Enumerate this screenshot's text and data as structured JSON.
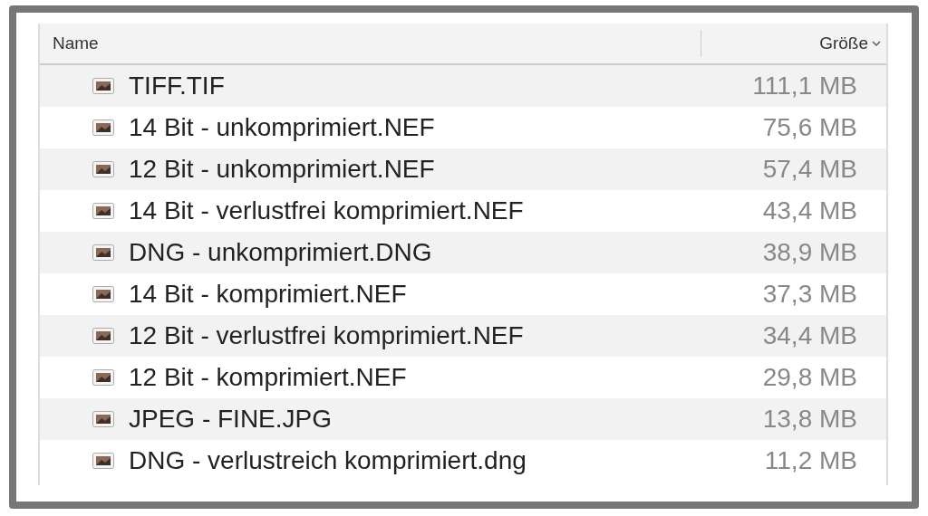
{
  "columns": [
    {
      "label": "Name"
    },
    {
      "label": "Größe"
    }
  ],
  "rows": [
    {
      "name": "TIFF.TIF",
      "size": "111,1 MB"
    },
    {
      "name": "14 Bit - unkomprimiert.NEF",
      "size": "75,6 MB"
    },
    {
      "name": "12 Bit - unkomprimiert.NEF",
      "size": "57,4 MB"
    },
    {
      "name": "14 Bit - verlustfrei komprimiert.NEF",
      "size": "43,4 MB"
    },
    {
      "name": "DNG - unkomprimiert.DNG",
      "size": "38,9 MB"
    },
    {
      "name": "14 Bit - komprimiert.NEF",
      "size": "37,3 MB"
    },
    {
      "name": "12 Bit - verlustfrei komprimiert.NEF",
      "size": "34,4 MB"
    },
    {
      "name": "12 Bit - komprimiert.NEF",
      "size": "29,8 MB"
    },
    {
      "name": "JPEG - FINE.JPG",
      "size": "13,8 MB"
    },
    {
      "name": "DNG - verlustreich komprimiert.dng",
      "size": "11,2 MB"
    }
  ]
}
